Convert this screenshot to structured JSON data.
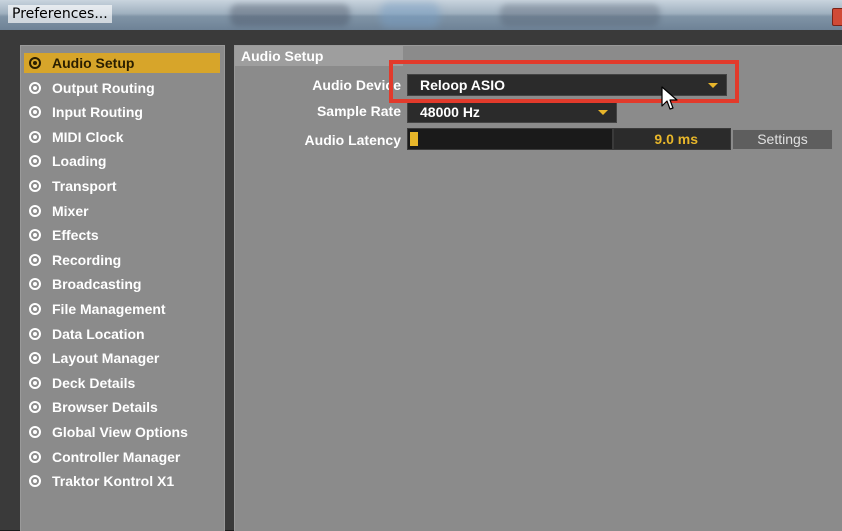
{
  "window": {
    "title": "Preferences..."
  },
  "sidebar": {
    "items": [
      {
        "label": "Audio Setup",
        "active": true
      },
      {
        "label": "Output Routing",
        "active": false
      },
      {
        "label": "Input Routing",
        "active": false
      },
      {
        "label": "MIDI Clock",
        "active": false
      },
      {
        "label": "Loading",
        "active": false
      },
      {
        "label": "Transport",
        "active": false
      },
      {
        "label": "Mixer",
        "active": false
      },
      {
        "label": "Effects",
        "active": false
      },
      {
        "label": "Recording",
        "active": false
      },
      {
        "label": "Broadcasting",
        "active": false
      },
      {
        "label": "File Management",
        "active": false
      },
      {
        "label": "Data Location",
        "active": false
      },
      {
        "label": "Layout Manager",
        "active": false
      },
      {
        "label": "Deck Details",
        "active": false
      },
      {
        "label": "Browser Details",
        "active": false
      },
      {
        "label": "Global View Options",
        "active": false
      },
      {
        "label": "Controller Manager",
        "active": false
      },
      {
        "label": "Traktor Kontrol X1",
        "active": false
      }
    ]
  },
  "main": {
    "header": "Audio Setup",
    "audio_device": {
      "label": "Audio Device",
      "value": "Reloop ASIO"
    },
    "sample_rate": {
      "label": "Sample Rate",
      "value": "48000 Hz"
    },
    "audio_latency": {
      "label": "Audio Latency",
      "value": "9.0 ms",
      "level_fraction": 0.04,
      "settings_label": "Settings"
    }
  },
  "colors": {
    "accent": "#d7a52a",
    "highlight_box": "#e23a2b",
    "panel_bg": "#8b8b8b"
  }
}
